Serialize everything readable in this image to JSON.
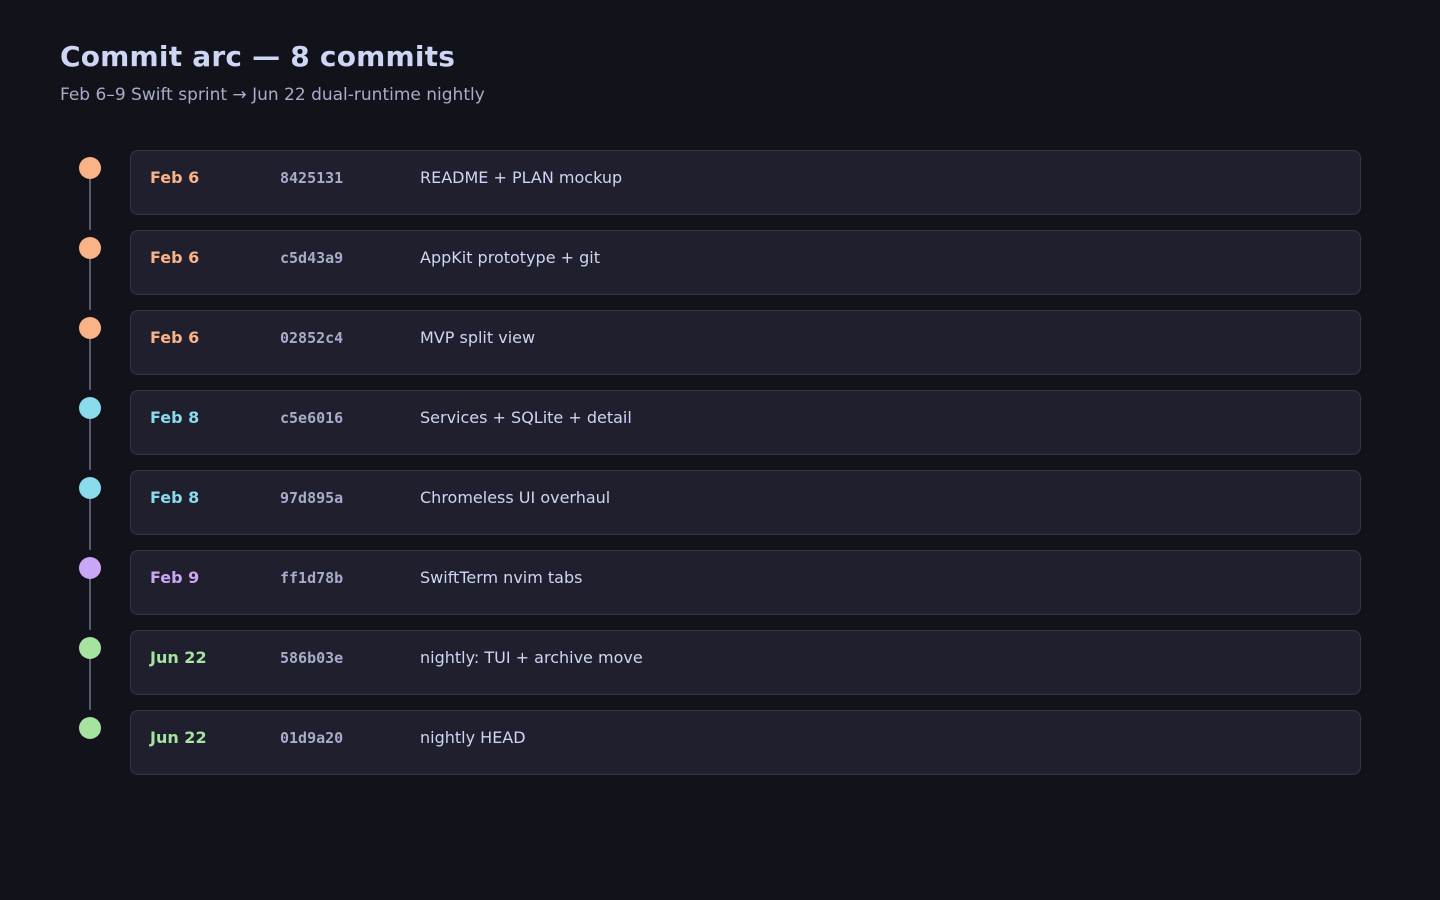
{
  "header": {
    "title": "Commit arc — 8 commits",
    "subtitle": "Feb 6–9 Swift sprint  →  Jun 22 dual-runtime nightly"
  },
  "colors": {
    "peach": "#fab387",
    "sky": "#89dceb",
    "mauve": "#cba6f7",
    "green": "#a6e3a1",
    "line": "#585b70",
    "card_bg": "#1f1f2e",
    "card_border": "#363648"
  },
  "commits": [
    {
      "date": "Feb 6",
      "hash": "8425131",
      "message": "README + PLAN mockup",
      "color": "#fab387"
    },
    {
      "date": "Feb 6",
      "hash": "c5d43a9",
      "message": "AppKit prototype + git",
      "color": "#fab387"
    },
    {
      "date": "Feb 6",
      "hash": "02852c4",
      "message": "MVP split view",
      "color": "#fab387"
    },
    {
      "date": "Feb 8",
      "hash": "c5e6016",
      "message": "Services + SQLite + detail",
      "color": "#89dceb"
    },
    {
      "date": "Feb 8",
      "hash": "97d895a",
      "message": "Chromeless UI overhaul",
      "color": "#89dceb"
    },
    {
      "date": "Feb 9",
      "hash": "ff1d78b",
      "message": "SwiftTerm nvim tabs",
      "color": "#cba6f7"
    },
    {
      "date": "Jun 22",
      "hash": "586b03e",
      "message": "nightly: TUI + archive move",
      "color": "#a6e3a1"
    },
    {
      "date": "Jun 22",
      "hash": "01d9a20",
      "message": "nightly HEAD",
      "color": "#a6e3a1"
    }
  ]
}
